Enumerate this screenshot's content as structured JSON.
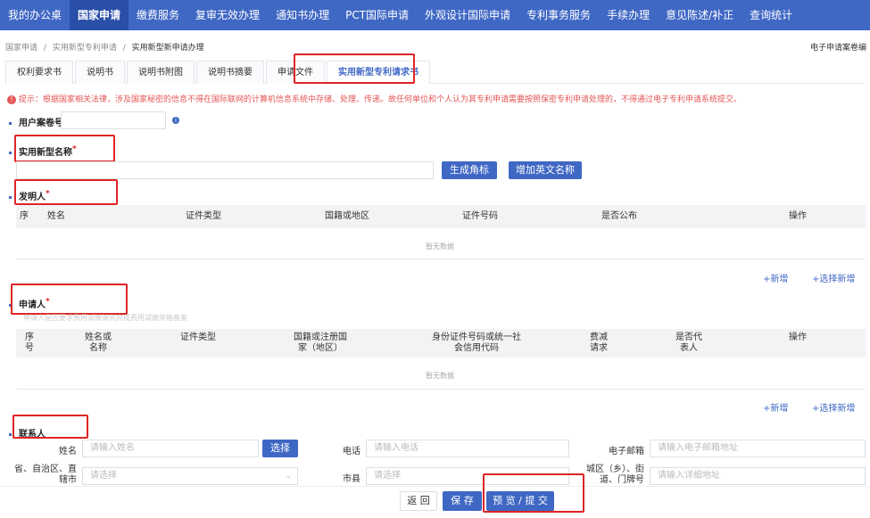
{
  "topnav": {
    "items": [
      "我的办公桌",
      "国家申请",
      "缴费服务",
      "复审无效办理",
      "通知书办理",
      "PCT国际申请",
      "外观设计国际申请",
      "专利事务服务",
      "手续办理",
      "意见陈述/补正",
      "查询统计"
    ],
    "active_index": 1
  },
  "breadcrumb": {
    "items": [
      "国家申请",
      "实用新型专利申请",
      "实用新型新申请办理"
    ],
    "separator": "/"
  },
  "right_note": "电子申请案卷编",
  "tabs": {
    "items": [
      "权利要求书",
      "说明书",
      "说明书附图",
      "说明书摘要",
      "申请文件",
      "实用新型专利请求书"
    ],
    "active_index": 5
  },
  "warning": {
    "icon": "warning-icon",
    "text": "提示：根据国家相关法律，涉及国家秘密的信息不得在国际联网的计算机信息系统中存储、处理、传递。故任何单位和个人认为其专利申请需要按照保密专利申请处理的，不得通过电子专利申请系统提交。"
  },
  "user_case_no": {
    "label": "用户案卷号"
  },
  "utility_name": {
    "label": "实用新型名称",
    "required": "*",
    "generate_button": "生成角标",
    "add_english_button": "增加英文名称"
  },
  "inventor": {
    "label": "发明人",
    "required": "*",
    "columns": [
      "序",
      "姓名",
      "证件类型",
      "国籍或地区",
      "证件号码",
      "是否公布",
      "操作"
    ],
    "empty_text": "暂无数据",
    "add_link": "+新增",
    "select_add_link": "+选择新增"
  },
  "applicant": {
    "label": "申请人",
    "required": "*",
    "hint": "申请人是否要求费用减缴请先完成费用减缴资格备案",
    "columns": [
      "序号",
      "姓名或名称",
      "证件类型",
      "国籍或注册国家（地区）",
      "身份证件号码或统一社会信用代码",
      "费减请求",
      "是否代表人",
      "操作"
    ],
    "empty_text": "暂无数据",
    "add_link": "+新增",
    "select_add_link": "+选择新增"
  },
  "contact": {
    "label": "联系人",
    "name_label": "姓名",
    "name_placeholder": "请输入姓名",
    "select_button": "选择",
    "phone_label": "电话",
    "phone_placeholder": "请输入电话",
    "email_label": "电子邮箱",
    "email_placeholder": "请输入电子邮箱地址",
    "province_label": "省、自治区、直辖市",
    "province_placeholder": "请选择",
    "city_label": "市县",
    "city_placeholder": "请选择",
    "district_label": "城区（乡）、街道、门牌号",
    "district_placeholder": "请输入详细地址"
  },
  "footer": {
    "back_button": "返 回",
    "save_button": "保 存",
    "preview_submit_button": "预 览 / 提 交"
  },
  "colors": {
    "primary": "#3f67c4",
    "nav_active": "#2a4fa8",
    "highlight_box": "#e02424",
    "warning": "#e45656"
  }
}
